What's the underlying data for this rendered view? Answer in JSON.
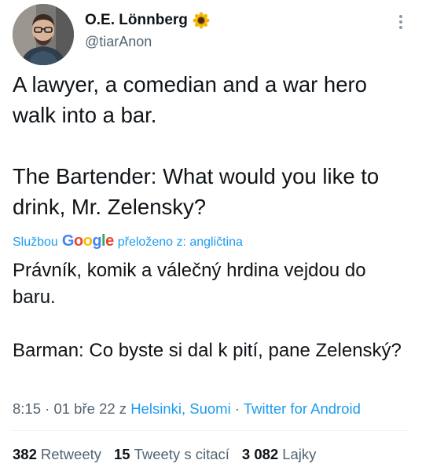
{
  "author": {
    "display_name": "O.E. Lönnberg",
    "handle": "@tiarAnon",
    "emoji_icon": "sunflower-icon"
  },
  "tweet": {
    "text": "A lawyer, a comedian and a war hero walk into a bar.\n\nThe Bartender: What would you like to drink, Mr. Zelensky?"
  },
  "translation": {
    "prefix": "Službou",
    "service": "Google",
    "suffix": "přeloženo z: angličtina",
    "text": "Právník, komik a válečný hrdina vejdou do baru.\n\n Barman: Co byste si dal k pití, pane Zelenský?"
  },
  "meta": {
    "time": "8:15",
    "date": "01 bře 22",
    "from_word": "z",
    "location": "Helsinki, Suomi",
    "separator": "·",
    "client": "Twitter for Android"
  },
  "stats": [
    {
      "count": "382",
      "label": "Retweety"
    },
    {
      "count": "15",
      "label": "Tweety s citací"
    },
    {
      "count": "3 082",
      "label": "Lajky"
    }
  ]
}
